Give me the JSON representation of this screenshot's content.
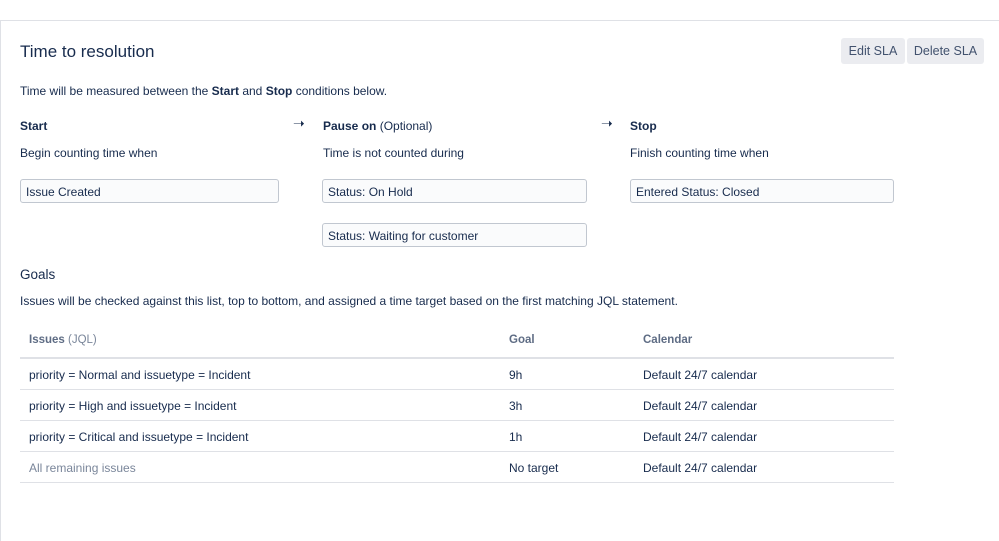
{
  "header": {
    "title": "Time to resolution",
    "edit_label": "Edit SLA",
    "delete_label": "Delete SLA"
  },
  "intro": {
    "before": "Time will be measured between the ",
    "start_word": "Start",
    "middle": " and ",
    "stop_word": "Stop",
    "after": " conditions below."
  },
  "arrow_glyph": "➝",
  "start": {
    "heading": "Start",
    "subtitle": "Begin counting time when",
    "conditions": [
      "Issue Created"
    ]
  },
  "pause": {
    "heading": "Pause on",
    "optional": "(Optional)",
    "subtitle": "Time is not counted during",
    "conditions": [
      "Status: On Hold",
      "Status: Waiting for customer"
    ]
  },
  "stop": {
    "heading": "Stop",
    "subtitle": "Finish counting time when",
    "conditions": [
      "Entered Status: Closed"
    ]
  },
  "goals": {
    "title": "Goals",
    "description": "Issues will be checked against this list, top to bottom, and assigned a time target based on the first matching JQL statement.",
    "headers": {
      "issues": "Issues",
      "issues_hint": "(JQL)",
      "goal": "Goal",
      "calendar": "Calendar"
    },
    "rows": [
      {
        "issues": "priority = Normal and issuetype = Incident",
        "goal": "9h",
        "calendar": "Default 24/7 calendar"
      },
      {
        "issues": "priority = High and issuetype = Incident",
        "goal": "3h",
        "calendar": "Default 24/7 calendar"
      },
      {
        "issues": "priority = Critical and issuetype = Incident",
        "goal": "1h",
        "calendar": "Default 24/7 calendar"
      },
      {
        "issues": "All remaining issues",
        "goal": "No target",
        "calendar": "Default 24/7 calendar"
      }
    ]
  }
}
